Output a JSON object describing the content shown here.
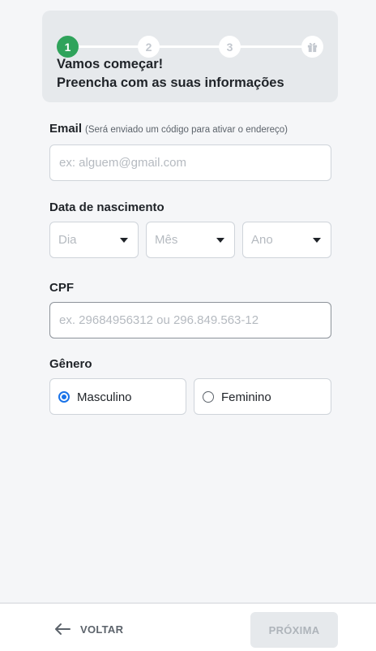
{
  "stepper": {
    "steps": [
      "1",
      "2",
      "3"
    ],
    "final_icon": "gift-icon",
    "active_step": 1,
    "title_line1": "Vamos começar!",
    "title_line2": "Preencha com as suas informações"
  },
  "email": {
    "label": "Email",
    "hint": "(Será enviado um código para ativar o endereço)",
    "placeholder": "ex: alguem@gmail.com",
    "value": ""
  },
  "birthdate": {
    "label": "Data de nascimento",
    "day_placeholder": "Dia",
    "month_placeholder": "Mês",
    "year_placeholder": "Ano"
  },
  "cpf": {
    "label": "CPF",
    "placeholder": "ex. 29684956312 ou 296.849.563-12",
    "value": ""
  },
  "gender": {
    "label": "Gênero",
    "options": [
      "Masculino",
      "Feminino"
    ],
    "selected": "Masculino"
  },
  "footer": {
    "back_label": "VOLTAR",
    "next_label": "PRÓXIMA"
  },
  "colors": {
    "accent_green": "#2fa35b",
    "radio_blue": "#1a73e8",
    "card_bg": "#e6e9ec",
    "page_bg": "#f5f6f8"
  }
}
